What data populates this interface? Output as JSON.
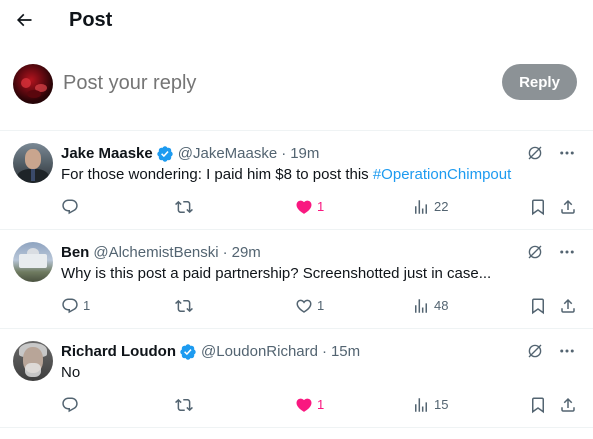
{
  "header": {
    "title": "Post"
  },
  "composer": {
    "placeholder": "Post your reply",
    "reply_label": "Reply"
  },
  "replies": [
    {
      "name": "Jake Maaske",
      "verified": true,
      "handle": "@JakeMaaske",
      "time": "19m",
      "text": "For those wondering: I paid him $8 to post this ",
      "hashtag": "#OperationChimpout",
      "reply_count": "",
      "retweet_count": "",
      "like_count": "1",
      "liked": true,
      "views": "22"
    },
    {
      "name": "Ben",
      "verified": false,
      "handle": "@AlchemistBenski",
      "time": "29m",
      "text": "Why is this post a paid partnership? Screenshotted just in case...",
      "hashtag": "",
      "reply_count": "1",
      "retweet_count": "",
      "like_count": "1",
      "liked": false,
      "views": "48"
    },
    {
      "name": "Richard Loudon",
      "verified": true,
      "handle": "@LoudonRichard",
      "time": "15m",
      "text": "No",
      "hashtag": "",
      "reply_count": "",
      "retweet_count": "",
      "like_count": "1",
      "liked": true,
      "views": "15"
    }
  ],
  "colors": {
    "accent": "#1d9bf0",
    "like": "#f91880",
    "muted": "#536471",
    "reply_button": "#8c9296"
  },
  "icons": [
    "back-arrow-icon",
    "verified-badge-icon",
    "grok-icon",
    "more-icon",
    "reply-icon",
    "retweet-icon",
    "heart-icon",
    "views-icon",
    "bookmark-icon",
    "share-icon"
  ]
}
